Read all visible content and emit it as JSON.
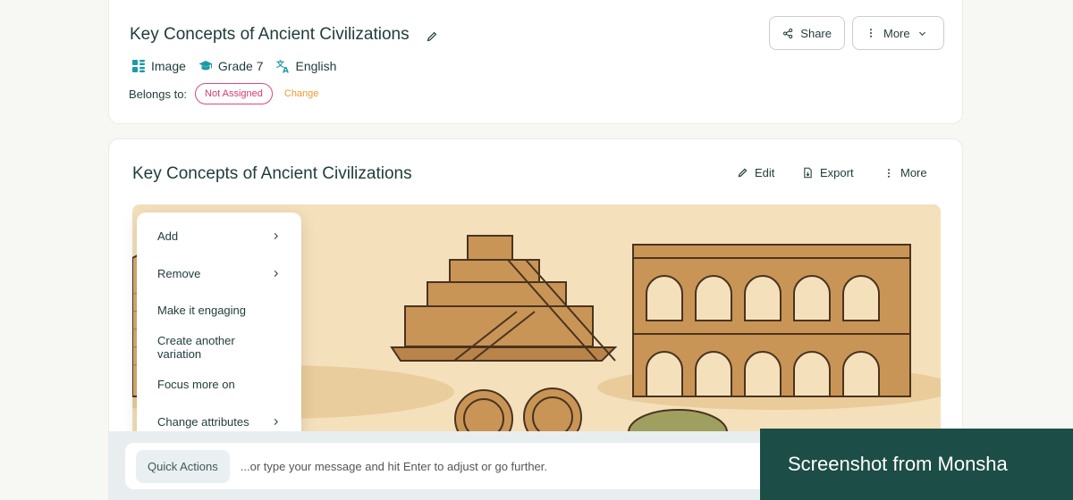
{
  "header": {
    "title": "Key Concepts of Ancient Civilizations",
    "meta": {
      "type": "Image",
      "grade": "Grade 7",
      "language": "English"
    },
    "belongs_label": "Belongs to:",
    "belongs_value": "Not Assigned",
    "change_label": "Change",
    "share_label": "Share",
    "more_label": "More"
  },
  "content": {
    "title": "Key Concepts of Ancient Civilizations",
    "edit_label": "Edit",
    "export_label": "Export",
    "more_label": "More"
  },
  "quick_menu": {
    "items": [
      {
        "label": "Add",
        "has_submenu": true
      },
      {
        "label": "Remove",
        "has_submenu": true
      },
      {
        "label": "Make it engaging",
        "has_submenu": false
      },
      {
        "label": "Create another variation",
        "has_submenu": false
      },
      {
        "label": "Focus more on",
        "has_submenu": false
      },
      {
        "label": "Change attributes",
        "has_submenu": true
      }
    ]
  },
  "composer": {
    "quick_actions_label": "Quick Actions",
    "placeholder": "...or type your message and hit Enter to adjust or go further."
  },
  "watermark": "Screenshot from Monsha",
  "colors": {
    "accent": "#1d4d47",
    "pink": "#d63a6c",
    "orange": "#e79b2d",
    "teal_icon": "#1b9aa6"
  }
}
